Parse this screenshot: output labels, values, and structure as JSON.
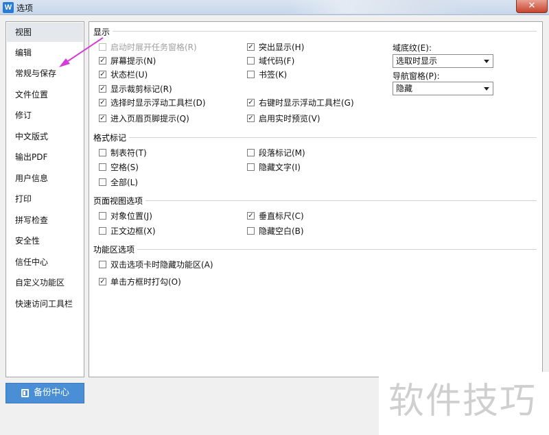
{
  "window": {
    "title": "选项",
    "app_icon": "W",
    "close_label": "✕"
  },
  "sidebar": {
    "items": [
      {
        "label": "视图",
        "selected": true
      },
      {
        "label": "编辑"
      },
      {
        "label": "常规与保存"
      },
      {
        "label": "文件位置"
      },
      {
        "label": "修订"
      },
      {
        "label": "中文版式"
      },
      {
        "label": "输出PDF"
      },
      {
        "label": "用户信息"
      },
      {
        "label": "打印"
      },
      {
        "label": "拼写检查"
      },
      {
        "label": "安全性"
      },
      {
        "label": "信任中心"
      },
      {
        "label": "自定义功能区"
      },
      {
        "label": "快速访问工具栏"
      }
    ]
  },
  "display": {
    "title": "显示",
    "options": {
      "start_taskpane": {
        "label": "启动时展开任务窗格(R)",
        "checked": false,
        "disabled": true
      },
      "screen_tips": {
        "label": "屏幕提示(N)",
        "checked": true
      },
      "status_bar": {
        "label": "状态栏(U)",
        "checked": true
      },
      "crop_marks": {
        "label": "显示裁剪标记(R)",
        "checked": true
      },
      "float_toolbar_select": {
        "label": "选择时显示浮动工具栏(D)",
        "checked": true
      },
      "header_footer_tip": {
        "label": "进入页眉页脚提示(Q)",
        "checked": true
      },
      "highlight": {
        "label": "突出显示(H)",
        "checked": true
      },
      "field_code": {
        "label": "域代码(F)",
        "checked": false
      },
      "bookmark": {
        "label": "书签(K)",
        "checked": false
      },
      "float_toolbar_rightclick": {
        "label": "右键时显示浮动工具栏(G)",
        "checked": true
      },
      "live_preview": {
        "label": "启用实时预览(V)",
        "checked": true
      }
    },
    "field_shading": {
      "label": "域底纹(E):",
      "value": "选取时显示"
    },
    "nav_pane": {
      "label": "导航窗格(P):",
      "value": "隐藏"
    }
  },
  "format_marks": {
    "title": "格式标记",
    "options": {
      "tab": {
        "label": "制表符(T)",
        "checked": false
      },
      "space": {
        "label": "空格(S)",
        "checked": false
      },
      "all": {
        "label": "全部(L)",
        "checked": false
      },
      "paragraph": {
        "label": "段落标记(M)",
        "checked": false
      },
      "hidden_text": {
        "label": "隐藏文字(I)",
        "checked": false
      }
    }
  },
  "page_view": {
    "title": "页面视图选项",
    "options": {
      "object_anchor": {
        "label": "对象位置(J)",
        "checked": false
      },
      "text_boundary": {
        "label": "正文边框(X)",
        "checked": false
      },
      "vertical_ruler": {
        "label": "垂直标尺(C)",
        "checked": true
      },
      "hide_whitespace": {
        "label": "隐藏空白(B)",
        "checked": false
      }
    }
  },
  "ribbon": {
    "title": "功能区选项",
    "options": {
      "dblclick_hide": {
        "label": "双击选项卡时隐藏功能区(A)",
        "checked": false
      },
      "click_tick": {
        "label": "单击方框时打勾(O)",
        "checked": true
      }
    }
  },
  "backup_button": {
    "label": "备份中心"
  },
  "watermark": {
    "text": "软件技巧"
  },
  "colors": {
    "accent_arrow": "#d63bd9",
    "button_blue": "#4a8fd6",
    "selected_bg": "#e4e8ec"
  }
}
